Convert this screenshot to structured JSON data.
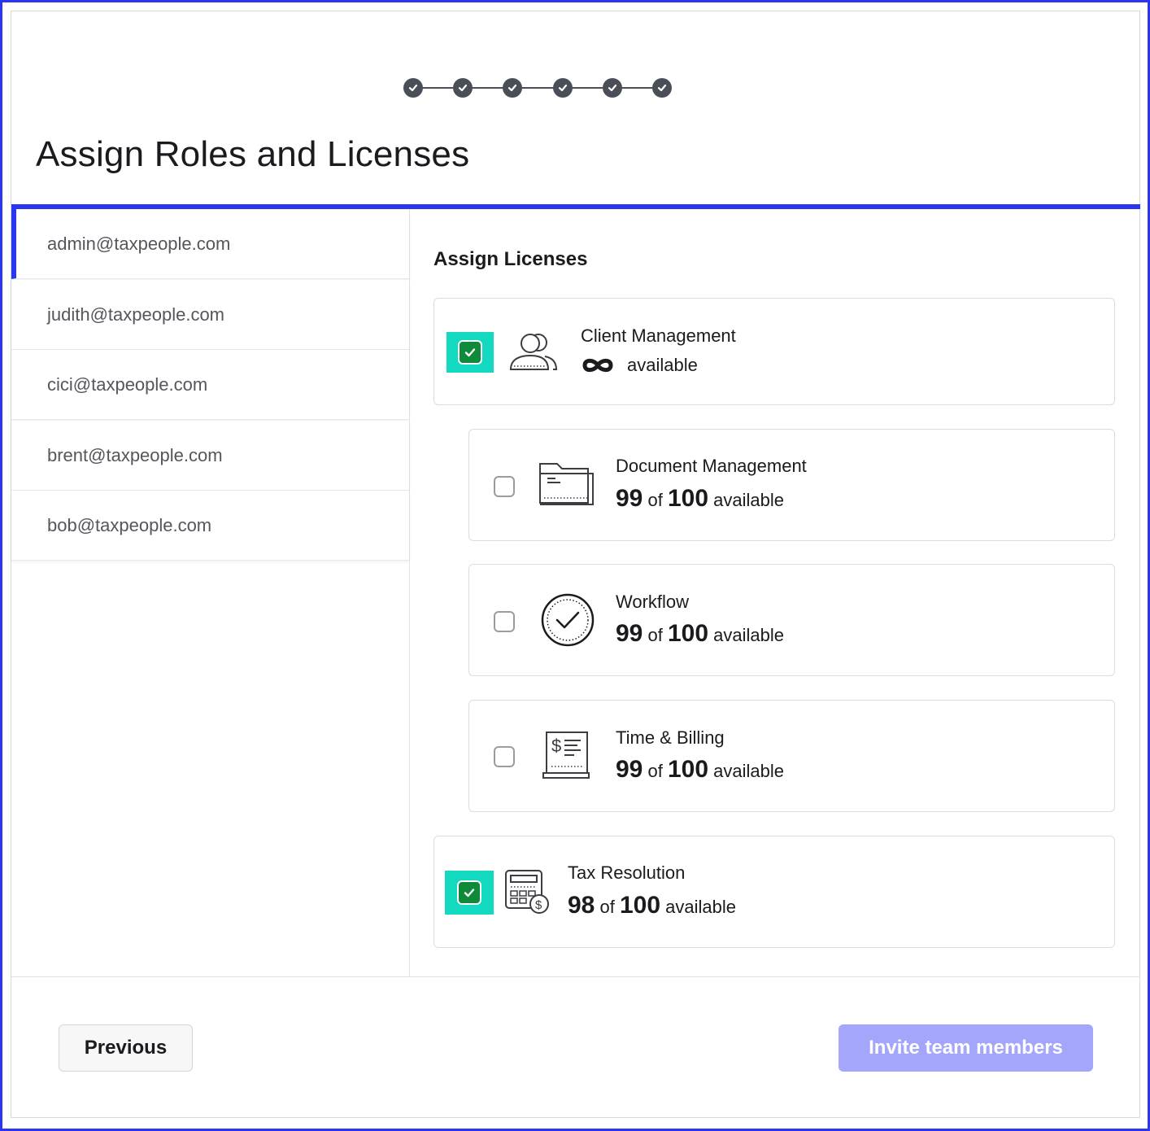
{
  "page": {
    "title": "Assign Roles and Licenses",
    "stepper_completed_steps": 6
  },
  "users": [
    {
      "email": "admin@taxpeople.com",
      "selected": true
    },
    {
      "email": "judith@taxpeople.com",
      "selected": false
    },
    {
      "email": "cici@taxpeople.com",
      "selected": false
    },
    {
      "email": "brent@taxpeople.com",
      "selected": false
    },
    {
      "email": "bob@taxpeople.com",
      "selected": false
    }
  ],
  "licenses": {
    "section_title": "Assign Licenses",
    "items": [
      {
        "name": "Client Management",
        "icon": "users-icon",
        "checked": true,
        "unlimited": true,
        "available_label": "available"
      },
      {
        "name": "Document Management",
        "icon": "folder-icon",
        "checked": false,
        "used": "99",
        "of_label": "of",
        "total": "100",
        "available_label": "available"
      },
      {
        "name": "Workflow",
        "icon": "check-circle-icon",
        "checked": false,
        "used": "99",
        "of_label": "of",
        "total": "100",
        "available_label": "available"
      },
      {
        "name": "Time & Billing",
        "icon": "invoice-icon",
        "checked": false,
        "used": "99",
        "of_label": "of",
        "total": "100",
        "available_label": "available"
      },
      {
        "name": "Tax Resolution",
        "icon": "calculator-icon",
        "checked": true,
        "used": "98",
        "of_label": "of",
        "total": "100",
        "available_label": "available"
      }
    ]
  },
  "footer": {
    "previous_label": "Previous",
    "invite_label": "Invite team members"
  },
  "colors": {
    "accent": "#2a36f0",
    "check_highlight": "#14d9c1",
    "checkbox_checked": "#0e8a3a",
    "invite_button_disabled": "#a4a6fb",
    "stepper": "#4a4f57"
  }
}
